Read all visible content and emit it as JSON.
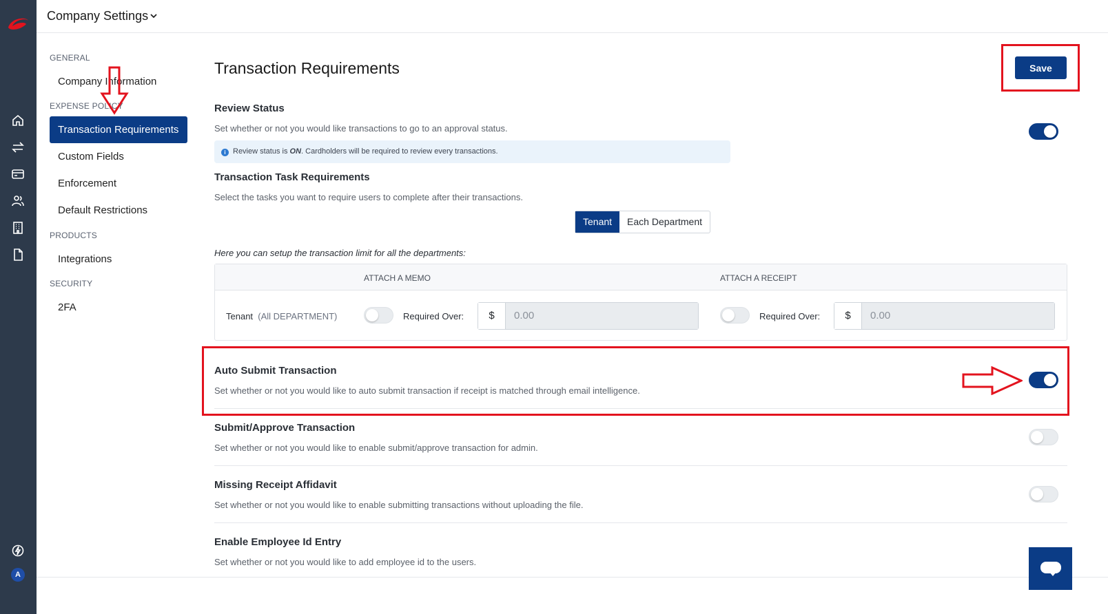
{
  "topbar": {
    "title": "Company Settings"
  },
  "sidebar": {
    "sections": [
      {
        "label": "GENERAL"
      },
      {
        "label": "EXPENSE POLICY"
      },
      {
        "label": "PRODUCTS"
      },
      {
        "label": "SECURITY"
      }
    ],
    "items": [
      {
        "label": "Company Information"
      },
      {
        "label": "Transaction Requirements",
        "active": true
      },
      {
        "label": "Custom Fields"
      },
      {
        "label": "Enforcement"
      },
      {
        "label": "Default Restrictions"
      },
      {
        "label": "Integrations"
      },
      {
        "label": "2FA"
      }
    ]
  },
  "rail": {
    "icons": [
      "home-icon",
      "transfer-icon",
      "card-icon",
      "users-icon",
      "building-icon",
      "document-icon",
      "support-icon"
    ],
    "avatar_initial": "A"
  },
  "main": {
    "title": "Transaction Requirements",
    "save_label": "Save",
    "review_status": {
      "heading": "Review Status",
      "description": "Set whether or not you would like transactions to go to an approval status.",
      "enabled": true,
      "info_prefix": "Review status is ",
      "info_state": "ON",
      "info_suffix": ". Cardholders will be required to review every transactions."
    },
    "task_requirements": {
      "heading": "Transaction Task Requirements",
      "description": "Select the tasks you want to require users to complete after their transactions.",
      "segments": [
        "Tenant",
        "Each Department"
      ],
      "selected_segment": "Tenant",
      "note": "Here you can setup the transaction limit for all the departments:",
      "table": {
        "headers": [
          "ATTACH A MEMO",
          "ATTACH A RECEIPT"
        ],
        "row": {
          "name": "Tenant",
          "scope": "(All DEPARTMENT)",
          "memo_enabled": false,
          "memo_label": "Required Over:",
          "memo_currency": "$",
          "memo_value": "0.00",
          "receipt_enabled": false,
          "receipt_label": "Required Over:",
          "receipt_currency": "$",
          "receipt_value": "0.00"
        }
      }
    },
    "auto_submit": {
      "heading": "Auto Submit Transaction",
      "description": "Set whether or not you would like to auto submit transaction if receipt is matched through email intelligence.",
      "enabled": true
    },
    "submit_approve": {
      "heading": "Submit/Approve Transaction",
      "description": "Set whether or not you would like to enable submit/approve transaction for admin.",
      "enabled": false
    },
    "missing_receipt": {
      "heading": "Missing Receipt Affidavit",
      "description": "Set whether or not you would like to enable submitting transactions without uploading the file.",
      "enabled": false
    },
    "employee_id": {
      "heading": "Enable Employee Id Entry",
      "description": "Set whether or not you would like to add employee id to the users.",
      "enabled": false
    }
  },
  "colors": {
    "brand": "#0b3c86",
    "rail": "#2d3a4b",
    "annotation": "#e3131e"
  }
}
